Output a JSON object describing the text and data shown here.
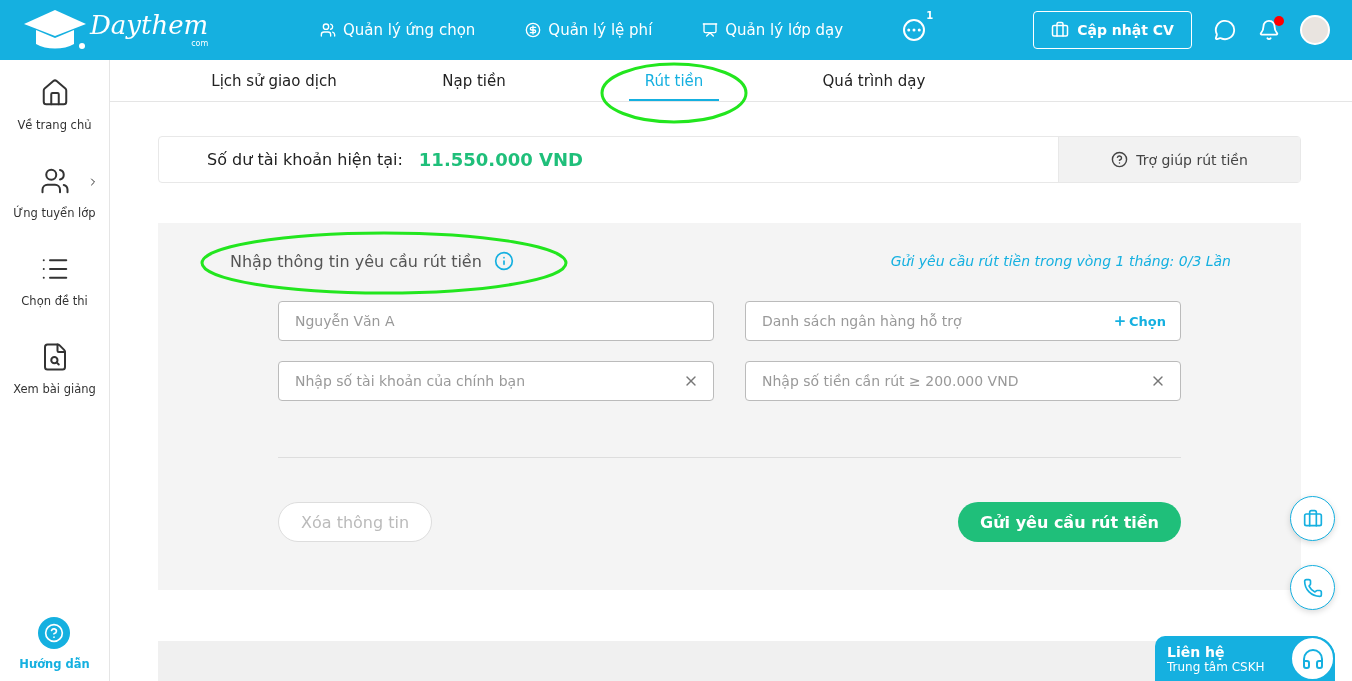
{
  "header": {
    "logo": {
      "name": "Daythem",
      "suffix": "com"
    },
    "nav": [
      {
        "label": "Quản lý ứng chọn"
      },
      {
        "label": "Quản lý lệ phí"
      },
      {
        "label": "Quản lý lớp dạy"
      }
    ],
    "more_count": "1",
    "cv_button": "Cập nhật CV",
    "notification_unread": true
  },
  "sidebar": {
    "items": [
      {
        "label": "Về trang chủ",
        "expandable": false
      },
      {
        "label": "Ứng tuyển lớp",
        "expandable": true
      },
      {
        "label": "Chọn đề thi",
        "expandable": false
      },
      {
        "label": "Xem bài giảng",
        "expandable": false
      }
    ],
    "guide": "Hướng dẫn"
  },
  "tabs": [
    {
      "label": "Lịch sử giao dịch",
      "selected": false,
      "circled": false
    },
    {
      "label": "Nạp tiền",
      "selected": false,
      "circled": false
    },
    {
      "label": "Rút tiền",
      "selected": true,
      "circled": true
    },
    {
      "label": "Quá trình dạy",
      "selected": false,
      "circled": false
    }
  ],
  "balance": {
    "label": "Số dư tài khoản hiện tại:",
    "amount": "11.550.000 VND",
    "help": "Trợ giúp rút tiền"
  },
  "form": {
    "title": "Nhập thông tin yêu cầu rút tiền",
    "title_circled": true,
    "quota": "Gửi yêu cầu rút tiền trong vòng 1 tháng: 0/3 Lần",
    "fields": [
      {
        "placeholder": "Nguyễn Văn A",
        "kind": "plain"
      },
      {
        "placeholder": "Danh sách ngân hàng hỗ trợ",
        "kind": "select",
        "action": "Chọn"
      },
      {
        "placeholder": "Nhập số tài khoản của chính bạn",
        "kind": "clear"
      },
      {
        "placeholder": "Nhập số tiền cần rút ≥ 200.000 VND",
        "kind": "clear"
      }
    ],
    "buttons": [
      {
        "label": "Xóa thông tin",
        "kind": "outline",
        "disabled": true
      },
      {
        "label": "Gửi yêu cầu rút tiền",
        "kind": "primary",
        "disabled": false
      }
    ]
  },
  "contact": {
    "title": "Liên hệ",
    "subtitle": "Trung tâm CSKH"
  }
}
